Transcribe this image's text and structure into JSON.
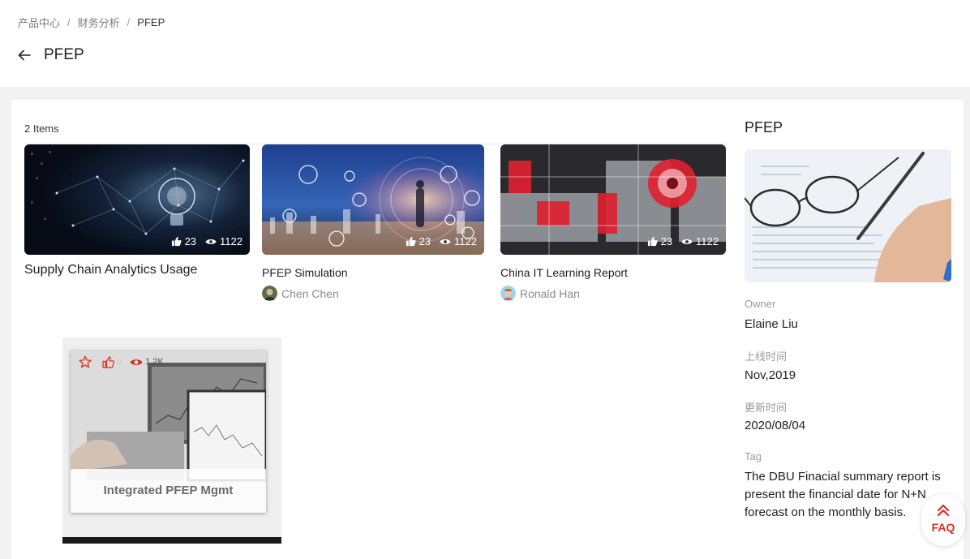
{
  "breadcrumb": {
    "items": [
      "产品中心",
      "财务分析",
      "PFEP"
    ],
    "separator": "/"
  },
  "header": {
    "title": "PFEP"
  },
  "list": {
    "count_label": "2 Items",
    "cards": [
      {
        "title": "Supply Chain Analytics Usage",
        "likes": "23",
        "views": "1122"
      },
      {
        "title": "PFEP Simulation",
        "author": "Chen Chen",
        "likes": "23",
        "views": "1122"
      },
      {
        "title": "China IT Learning Report",
        "author": "Ronald Han",
        "likes": "23",
        "views": "1122"
      }
    ]
  },
  "tile": {
    "label": "Integrated PFEP Mgmt",
    "likes": "0",
    "views": "1.2K"
  },
  "sidebar": {
    "title": "PFEP",
    "owner_label": "Owner",
    "owner": "Elaine Liu",
    "online_label": "上线时间",
    "online": "Nov,2019",
    "updated_label": "更新时间",
    "updated": "2020/08/04",
    "tag_label": "Tag",
    "tag": "The DBU Finacial summary report is present the financial date for N+N forecast on the monthly basis."
  },
  "faq": {
    "label": "FAQ"
  },
  "colors": {
    "accent": "#d93025",
    "panel": "#ffffff",
    "background": "#f2f2f2"
  }
}
